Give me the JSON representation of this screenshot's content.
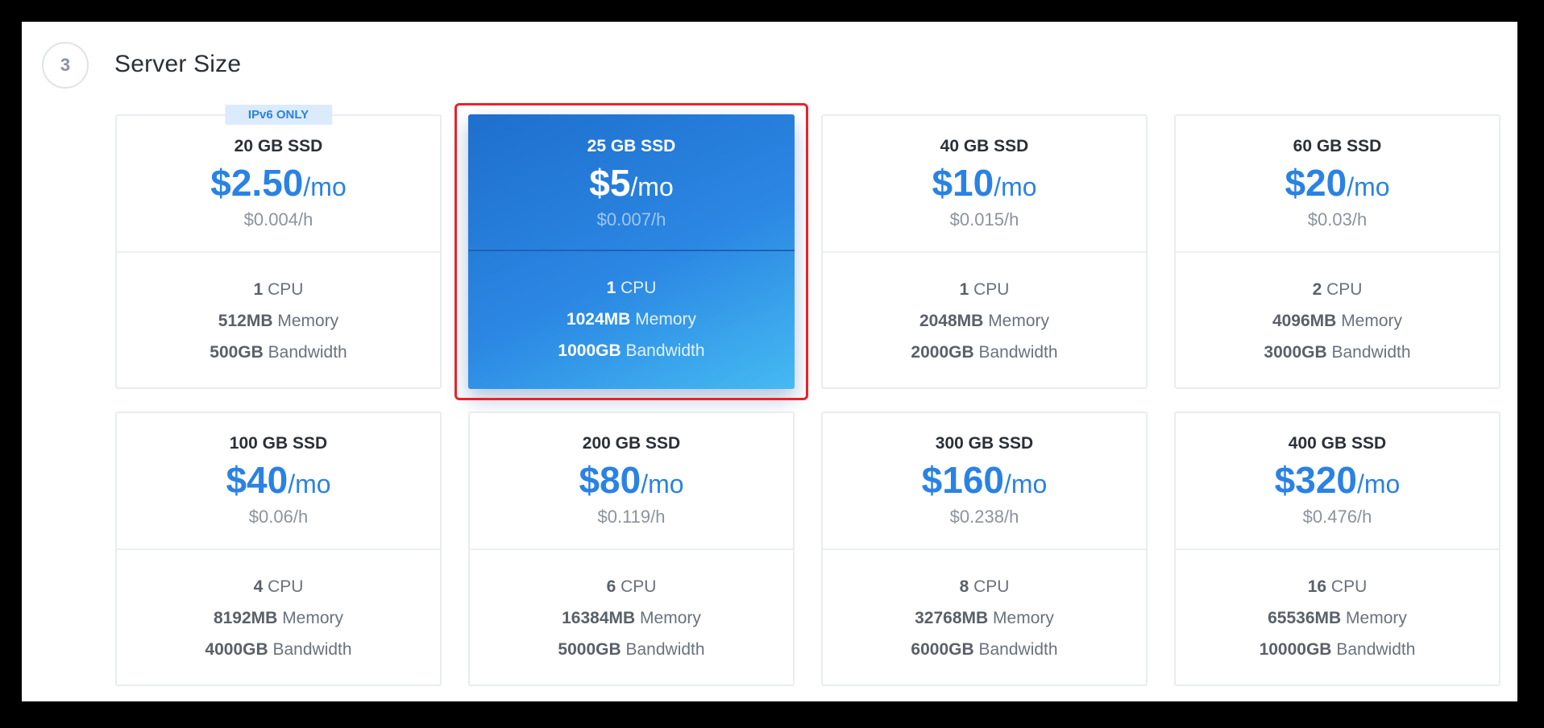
{
  "section": {
    "step": "3",
    "title": "Server Size"
  },
  "colors": {
    "accent": "#2a82e4",
    "highlight": "#e8232a"
  },
  "plans": [
    {
      "disk": "20 GB SSD",
      "price": "$2.50",
      "per": "/mo",
      "hourly": "$0.004/h",
      "cpu": "1",
      "cpu_label": "CPU",
      "memory": "512MB",
      "memory_label": "Memory",
      "bandwidth": "500GB",
      "bandwidth_label": "Bandwidth",
      "badge": "IPv6 ONLY"
    },
    {
      "disk": "25 GB SSD",
      "price": "$5",
      "per": "/mo",
      "hourly": "$0.007/h",
      "cpu": "1",
      "cpu_label": "CPU",
      "memory": "1024MB",
      "memory_label": "Memory",
      "bandwidth": "1000GB",
      "bandwidth_label": "Bandwidth",
      "selected": true
    },
    {
      "disk": "40 GB SSD",
      "price": "$10",
      "per": "/mo",
      "hourly": "$0.015/h",
      "cpu": "1",
      "cpu_label": "CPU",
      "memory": "2048MB",
      "memory_label": "Memory",
      "bandwidth": "2000GB",
      "bandwidth_label": "Bandwidth"
    },
    {
      "disk": "60 GB SSD",
      "price": "$20",
      "per": "/mo",
      "hourly": "$0.03/h",
      "cpu": "2",
      "cpu_label": "CPU",
      "memory": "4096MB",
      "memory_label": "Memory",
      "bandwidth": "3000GB",
      "bandwidth_label": "Bandwidth"
    },
    {
      "disk": "100 GB SSD",
      "price": "$40",
      "per": "/mo",
      "hourly": "$0.06/h",
      "cpu": "4",
      "cpu_label": "CPU",
      "memory": "8192MB",
      "memory_label": "Memory",
      "bandwidth": "4000GB",
      "bandwidth_label": "Bandwidth"
    },
    {
      "disk": "200 GB SSD",
      "price": "$80",
      "per": "/mo",
      "hourly": "$0.119/h",
      "cpu": "6",
      "cpu_label": "CPU",
      "memory": "16384MB",
      "memory_label": "Memory",
      "bandwidth": "5000GB",
      "bandwidth_label": "Bandwidth"
    },
    {
      "disk": "300 GB SSD",
      "price": "$160",
      "per": "/mo",
      "hourly": "$0.238/h",
      "cpu": "8",
      "cpu_label": "CPU",
      "memory": "32768MB",
      "memory_label": "Memory",
      "bandwidth": "6000GB",
      "bandwidth_label": "Bandwidth"
    },
    {
      "disk": "400 GB SSD",
      "price": "$320",
      "per": "/mo",
      "hourly": "$0.476/h",
      "cpu": "16",
      "cpu_label": "CPU",
      "memory": "65536MB",
      "memory_label": "Memory",
      "bandwidth": "10000GB",
      "bandwidth_label": "Bandwidth"
    }
  ]
}
